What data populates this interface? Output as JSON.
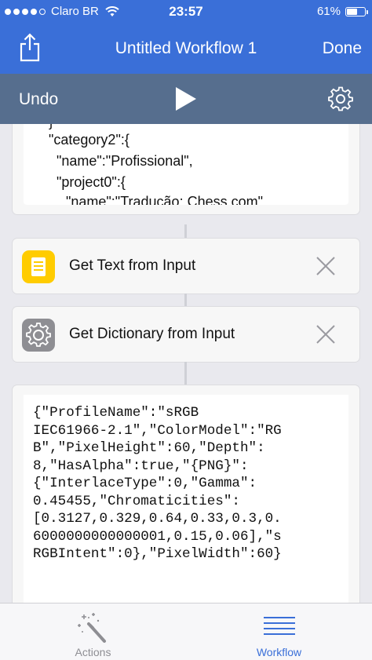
{
  "status_bar": {
    "carrier": "Claro BR",
    "time": "23:57",
    "battery_text": "61%",
    "battery_level": 0.61
  },
  "nav": {
    "title": "Untitled Workflow 1",
    "done_label": "Done"
  },
  "toolbar": {
    "undo_label": "Undo"
  },
  "text_block_top": {
    "lines": [
      "}",
      "\"category2\":{",
      "\"name\":\"Profissional\",",
      "\"project0\":{",
      "\"name\":\"Tradução: Chess.com\","
    ]
  },
  "actions": [
    {
      "label": "Get Text from Input",
      "icon": "text-document-icon",
      "color": "#ffcc00"
    },
    {
      "label": "Get Dictionary from Input",
      "icon": "gear-icon",
      "color": "#8e8e93"
    }
  ],
  "result": {
    "lines": [
      "{\"ProfileName\":\"sRGB",
      "IEC61966-2.1\",\"ColorModel\":\"RG",
      "B\",\"PixelHeight\":60,\"Depth\":",
      "8,\"HasAlpha\":true,\"{PNG}\":",
      "{\"InterlaceType\":0,\"Gamma\":",
      "0.45455,\"Chromaticities\":",
      "[0.3127,0.329,0.64,0.33,0.3,0.",
      "6000000000000001,0.15,0.06],\"s",
      "RGBIntent\":0},\"PixelWidth\":60}"
    ]
  },
  "tabs": [
    {
      "label": "Actions",
      "icon": "magic-wand-icon",
      "active": false
    },
    {
      "label": "Workflow",
      "icon": "list-icon",
      "active": true
    }
  ],
  "colors": {
    "accent": "#3a6fd8",
    "toolbar": "#566e8e"
  }
}
